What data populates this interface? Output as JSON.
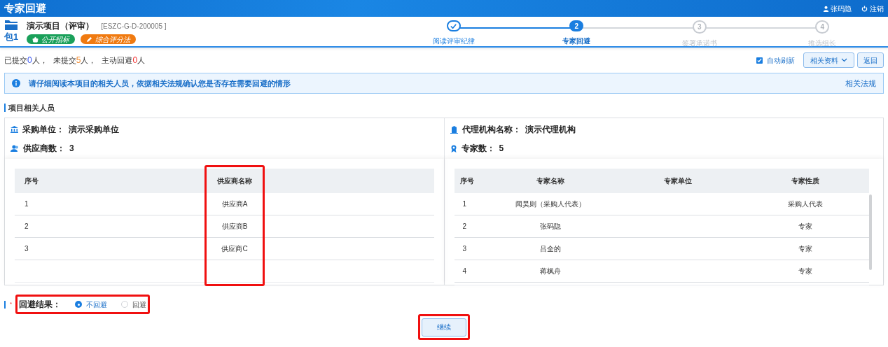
{
  "header": {
    "title": "专家回避",
    "user": "张码隐",
    "logout": "注销"
  },
  "project": {
    "package": "包1",
    "name": "演示项目（评审）",
    "code": "[ESZC-G-D-200005 ]",
    "tags": [
      {
        "label": "公开招标",
        "color": "#1aa05a",
        "kind": "basket"
      },
      {
        "label": "综合评分法",
        "color": "#f07a10",
        "kind": "pen"
      }
    ]
  },
  "steps": [
    {
      "label": "阅读评审纪律",
      "completed": true,
      "selected": false
    },
    {
      "number": "2",
      "label": "专家回避",
      "completed": false,
      "selected": true
    },
    {
      "number": "3",
      "label": "签署承诺书",
      "completed": false,
      "selected": false
    },
    {
      "number": "4",
      "label": "推选组长",
      "completed": false,
      "selected": false
    }
  ],
  "summary": [
    {
      "label": "已提交",
      "count": "0",
      "unit": "人，",
      "color": "#2f4cf0"
    },
    {
      "label": "未提交",
      "count": "5",
      "unit": "人，",
      "color": "#f08a30"
    },
    {
      "label": "主动回避",
      "count": "0",
      "unit": "人",
      "color": "#f02a2a"
    }
  ],
  "toolbar": {
    "auto_refresh": {
      "label": "自动刷新",
      "checked": true
    },
    "materials_button": "相关资料",
    "back_button": "返回"
  },
  "notice": {
    "text": "请仔细阅读本项目的相关人员，依据相关法规确认您是否存在需要回避的情形",
    "link": "相关法规"
  },
  "section_title": "项目相关人员",
  "purchaser": {
    "label": "采购单位：",
    "value": "演示采购单位"
  },
  "supplier_count": {
    "label": "供应商数：",
    "value": "3"
  },
  "agency": {
    "label": "代理机构名称：",
    "value": "演示代理机构"
  },
  "expert_count": {
    "label": "专家数：",
    "value": "5"
  },
  "supplier_table": {
    "columns": [
      {
        "label": "序号",
        "highlighted": false
      },
      {
        "label": "供应商名称",
        "highlighted": true
      }
    ],
    "rows": [
      [
        "1",
        "供应商A"
      ],
      [
        "2",
        "供应商B"
      ],
      [
        "3",
        "供应商C"
      ]
    ]
  },
  "expert_table": {
    "columns": [
      "序号",
      "专家名称",
      "专家单位",
      "专家性质"
    ],
    "rows": [
      {
        "index": "1",
        "name": "闻昊则（采购人代表）",
        "nature": "采购人代表"
      },
      {
        "index": "2",
        "name": "张码隐",
        "nature": "专家"
      },
      {
        "index": "3",
        "name": "吕全的",
        "nature": "专家"
      },
      {
        "index": "4",
        "name": "蒋枫舟",
        "nature": "专家"
      }
    ]
  },
  "result": {
    "label": "回避结果：",
    "required_mark": "*",
    "highlighted": true,
    "options": [
      {
        "label": "不回避",
        "selected": true
      },
      {
        "label": "回避",
        "selected": false
      }
    ]
  },
  "continue_button": {
    "label": "继续",
    "highlighted": true
  }
}
